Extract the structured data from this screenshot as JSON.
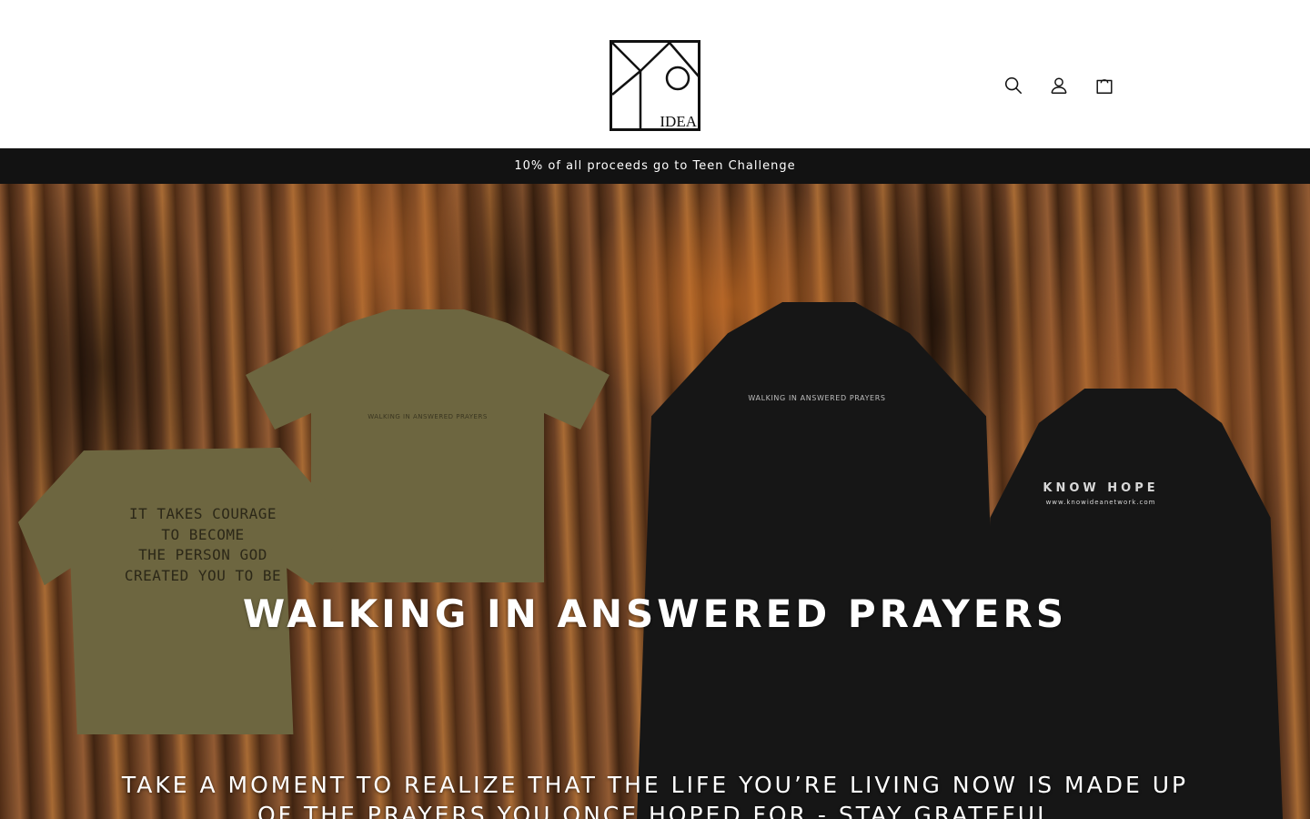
{
  "header": {
    "logo_text": "IDEA",
    "search_label": "Search",
    "account_label": "Log in",
    "cart_label": "Cart"
  },
  "announcement": {
    "text": "10% of all proceeds go to Teen Challenge"
  },
  "hero": {
    "tee_front_print": "WALKING IN ANSWERED PRAYERS",
    "tee_back_print": [
      "IT TAKES COURAGE",
      "TO BECOME",
      "THE PERSON GOD",
      "CREATED YOU TO BE"
    ],
    "hoodie_front_print": "WALKING IN ANSWERED PRAYERS",
    "hoodie_back_title": "KNOW HOPE",
    "hoodie_back_url": "www.knowideanetwork.com",
    "heading": "WALKING IN ANSWERED PRAYERS",
    "subheading": "TAKE A MOMENT TO REALIZE THAT THE LIFE YOU’RE LIVING NOW IS MADE UP OF THE PRAYERS YOU ONCE HOPED FOR - STAY GRATEFUL"
  },
  "colors": {
    "announcement_bg": "#121212",
    "header_bg": "#ffffff",
    "text": "#121212"
  },
  "icons": [
    "search-icon",
    "account-icon",
    "cart-icon"
  ]
}
